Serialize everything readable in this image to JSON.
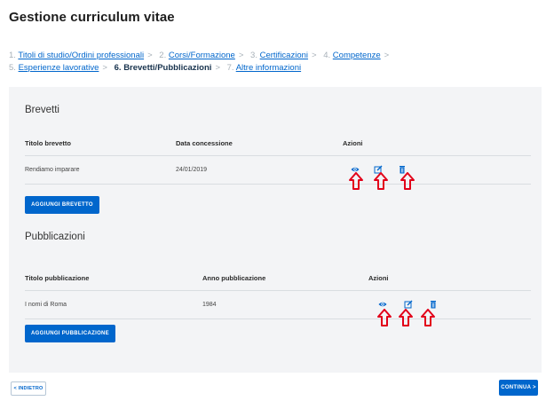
{
  "page": {
    "title": "Gestione curriculum vitae"
  },
  "steps": [
    {
      "num": "1.",
      "label": "Titoli di studio/Ordini professionali",
      "sep": ">"
    },
    {
      "num": "2.",
      "label": "Corsi/Formazione",
      "sep": ">"
    },
    {
      "num": "3.",
      "label": "Certificazioni",
      "sep": ">"
    },
    {
      "num": "4.",
      "label": "Competenze",
      "sep": ">"
    },
    {
      "num": "5.",
      "label": "Esperienze lavorative",
      "sep": ">"
    },
    {
      "num": "6.",
      "label": "Brevetti/Pubblicazioni",
      "sep": ">"
    },
    {
      "num": "7.",
      "label": "Altre informazioni",
      "sep": ""
    }
  ],
  "brevetti": {
    "title": "Brevetti",
    "columns": [
      "Titolo brevetto",
      "Data concessione",
      "Azioni"
    ],
    "rows": [
      {
        "titolo": "Rendiamo imparare",
        "data": "24/01/2019"
      }
    ],
    "add_button": "Aggiungi brevetto"
  },
  "pubblicazioni": {
    "title": "Pubblicazioni",
    "columns": [
      "Titolo pubblicazione",
      "Anno pubblicazione",
      "Azioni"
    ],
    "rows": [
      {
        "titolo": "I nomi di Roma",
        "anno": "1984"
      }
    ],
    "add_button": "Aggiungi pubblicazione"
  },
  "footer": {
    "back_label": "< Indietro",
    "next_label": "Continua >"
  },
  "icons": {
    "view": "eye-icon",
    "edit": "pencil-icon",
    "delete": "trash-icon",
    "annotation": "arrow-up-outline-icon"
  },
  "colors": {
    "accent": "#0066cc",
    "annotation": "#e2001a",
    "panel": "#f3f4f6"
  }
}
